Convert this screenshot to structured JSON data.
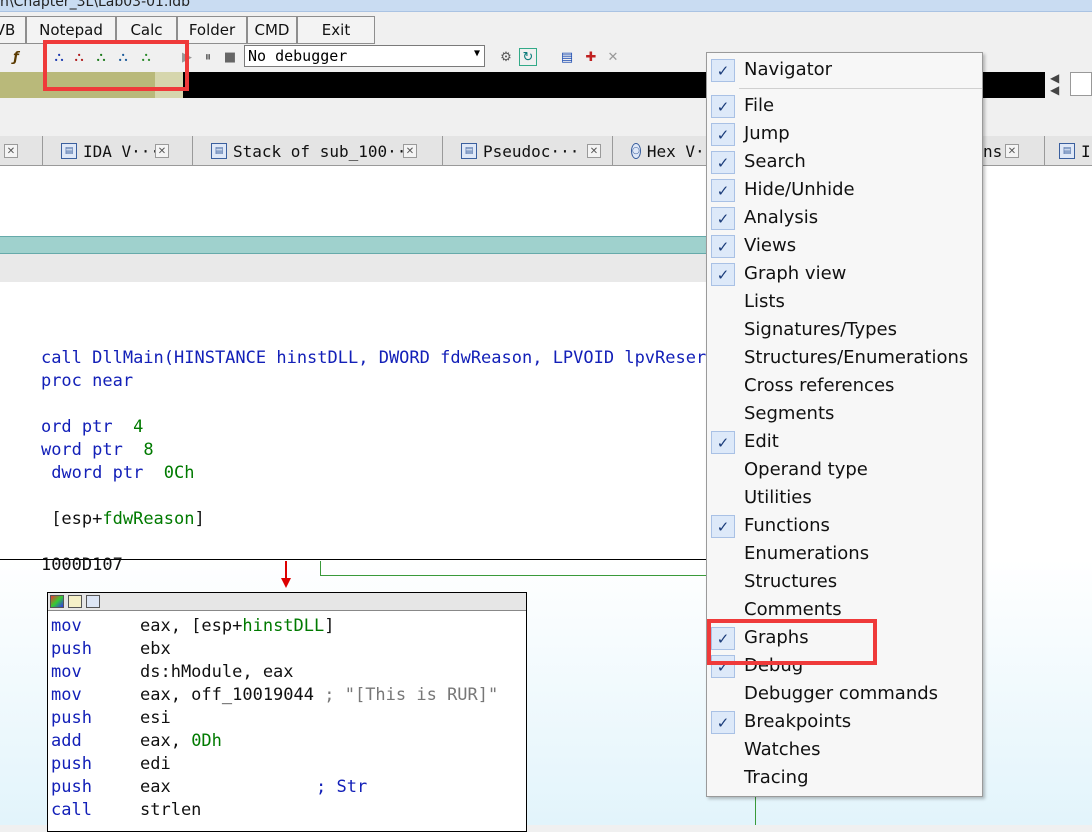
{
  "window": {
    "title": "n\\Chapter_3L\\Lab03-01.idb"
  },
  "top_buttons": [
    {
      "label": "VB"
    },
    {
      "label": "Notepad"
    },
    {
      "label": "Calc"
    },
    {
      "label": "Folder"
    },
    {
      "label": "CMD"
    },
    {
      "label": "Exit"
    }
  ],
  "toolbar": {
    "debugger_value": "No debugger",
    "icons": [
      "function-icon",
      "graph-flow-icon",
      "graph-xref-to-icon",
      "graph-xref-from-icon",
      "graph-user-xrefs-icon",
      "graph-user-chart-icon",
      "pause-icon",
      "stop-icon",
      "attach-process-icon",
      "run-icon",
      "breakpoints-icon",
      "add-breakpoint-icon",
      "delete-breakpoint-icon"
    ]
  },
  "tabs": [
    {
      "label": ""
    },
    {
      "label": "IDA V···"
    },
    {
      "label": "Stack of sub_100···"
    },
    {
      "label": "Pseudoc···"
    },
    {
      "label": "Hex V···"
    },
    {
      "label": "ns"
    },
    {
      "label": "I"
    }
  ],
  "code_top": [
    {
      "text": "call DllMain(HINSTANCE hinstDLL, DWORD fdwReason, LPVOID lpvReser",
      "color": "blue"
    },
    {
      "text": "proc near",
      "color": "blue"
    },
    {
      "text": "",
      "color": "black"
    },
    {
      "text": "ord ptr  4",
      "color": "blue"
    },
    {
      "text": "word ptr  8",
      "color": "blue"
    },
    {
      "text": " dword ptr  0Ch",
      "color": "blue"
    },
    {
      "text": "",
      "color": "black"
    },
    {
      "text": " [esp+fdwReason]",
      "color": "black"
    },
    {
      "text": "",
      "color": "black"
    },
    {
      "text": "1000D107",
      "color": "black"
    }
  ],
  "code_block": [
    {
      "mn": "mov",
      "op": "eax, [esp+hinstDLL]"
    },
    {
      "mn": "push",
      "op": "ebx"
    },
    {
      "mn": "mov",
      "op": "ds:hModule, eax"
    },
    {
      "mn": "mov",
      "op": "eax, off_10019044",
      "cmt": "; \"[This is RUR]\""
    },
    {
      "mn": "push",
      "op": "esi"
    },
    {
      "mn": "add",
      "op": "eax, 0Dh"
    },
    {
      "mn": "push",
      "op": "edi"
    },
    {
      "mn": "push",
      "op": "eax",
      "cmt": "; Str"
    },
    {
      "mn": "call",
      "op": "strlen"
    }
  ],
  "menu": {
    "items": [
      {
        "label": "Navigator",
        "checked": true
      },
      {
        "label": "File",
        "checked": true
      },
      {
        "label": "Jump",
        "checked": true
      },
      {
        "label": "Search",
        "checked": true
      },
      {
        "label": "Hide/Unhide",
        "checked": true
      },
      {
        "label": "Analysis",
        "checked": true
      },
      {
        "label": "Views",
        "checked": true
      },
      {
        "label": "Graph view",
        "checked": true
      },
      {
        "label": "Lists",
        "checked": false
      },
      {
        "label": "Signatures/Types",
        "checked": false
      },
      {
        "label": "Structures/Enumerations",
        "checked": false
      },
      {
        "label": "Cross references",
        "checked": false
      },
      {
        "label": "Segments",
        "checked": false
      },
      {
        "label": "Edit",
        "checked": true
      },
      {
        "label": "Operand type",
        "checked": false
      },
      {
        "label": "Utilities",
        "checked": false
      },
      {
        "label": "Functions",
        "checked": true
      },
      {
        "label": "Enumerations",
        "checked": false
      },
      {
        "label": "Structures",
        "checked": false
      },
      {
        "label": "Comments",
        "checked": false
      },
      {
        "label": "Graphs",
        "checked": true
      },
      {
        "label": "Debug",
        "checked": true
      },
      {
        "label": "Debugger commands",
        "checked": false
      },
      {
        "label": "Breakpoints",
        "checked": true
      },
      {
        "label": "Watches",
        "checked": false
      },
      {
        "label": "Tracing",
        "checked": false
      }
    ]
  },
  "colors": {
    "highlight": "#ef3a3a",
    "code_blue": "#1320b8",
    "code_green": "#007a00"
  }
}
